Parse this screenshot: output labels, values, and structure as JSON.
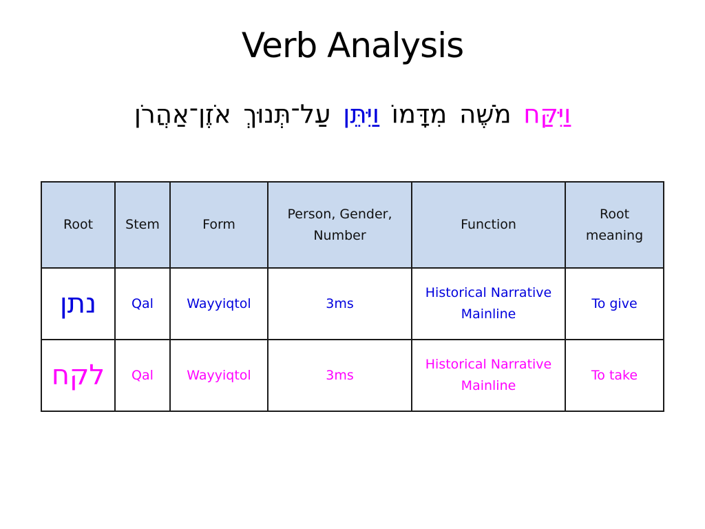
{
  "slide": {
    "title": "Verb Analysis"
  },
  "verse": {
    "words": [
      {
        "text": "וַיִּקַּח",
        "highlight": "take"
      },
      {
        "text": "מֹשֶׁה",
        "highlight": "none"
      },
      {
        "text": "מִדָּמוֹ",
        "highlight": "none"
      },
      {
        "text": "וַיִּתֵּן",
        "highlight": "give"
      },
      {
        "text": "עַל־תְּנוּךְ",
        "highlight": "none"
      },
      {
        "text": "אֹזֶן־אַהֲרֹן",
        "highlight": "none"
      }
    ]
  },
  "colors": {
    "take": "#ff00ff",
    "give": "#0000dd",
    "header_bg": "#c9d9ee",
    "border": "#1a1a1a"
  },
  "table": {
    "headers": {
      "root": "Root",
      "stem": "Stem",
      "form": "Form",
      "pgn_line1": "Person, Gender,",
      "pgn_line2": "Number",
      "function": "Function",
      "meaning_line1": "Root",
      "meaning_line2": "meaning"
    },
    "rows": [
      {
        "root": "נתן",
        "stem": "Qal",
        "form": "Wayyiqtol",
        "pgn": "3ms",
        "function_line1": "Historical Narrative",
        "function_line2": "Mainline",
        "meaning": "To give"
      },
      {
        "root": "לקח",
        "stem": "Qal",
        "form": "Wayyiqtol",
        "pgn": "3ms",
        "function_line1": "Historical Narrative",
        "function_line2": "Mainline",
        "meaning": "To take"
      }
    ]
  }
}
